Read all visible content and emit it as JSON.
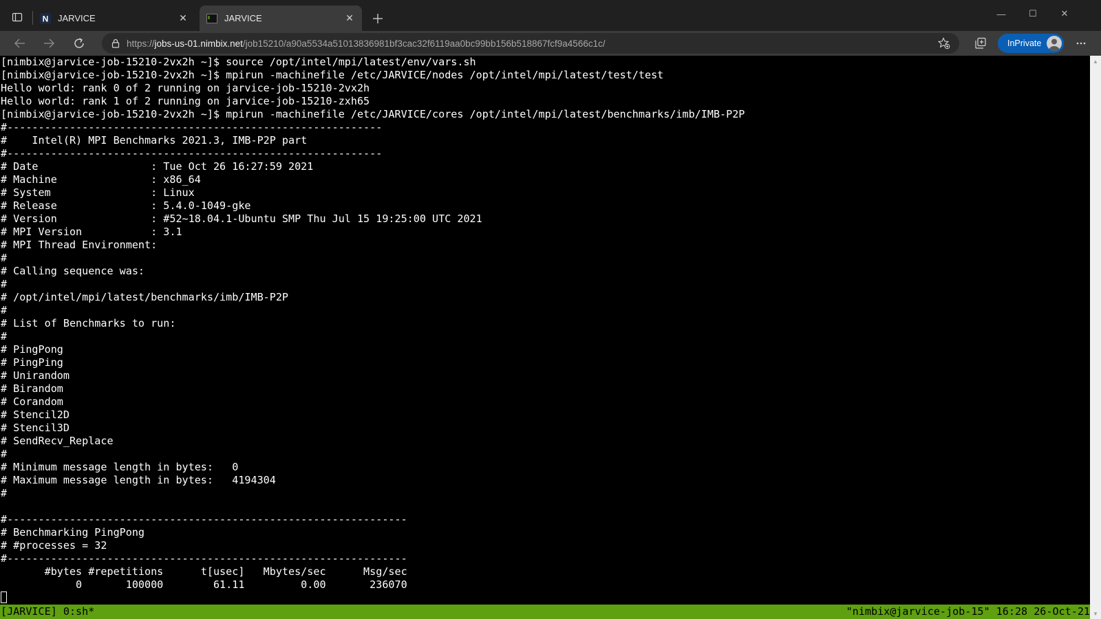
{
  "browser": {
    "tabs": [
      {
        "title": "JARVICE",
        "favicon": "N",
        "active": false
      },
      {
        "title": "JARVICE",
        "favicon": "terminal",
        "active": true
      }
    ],
    "window_controls": {
      "minimize": "—",
      "maximize": "☐",
      "close": "✕"
    },
    "url": {
      "scheme": "https://",
      "host": "jobs-us-01.nimbix.net",
      "path": "/job15210/a90a5534a51013836981bf3cac32f6119aa0bc99bb156b518867fcf9a4566c1c/"
    },
    "inprivate_label": "InPrivate",
    "colors": {
      "frame": "#202020",
      "toolbar": "#3b3b3b",
      "inprivate": "#0a5fb4"
    }
  },
  "terminal": {
    "lines": [
      "[nimbix@jarvice-job-15210-2vx2h ~]$ source /opt/intel/mpi/latest/env/vars.sh",
      "[nimbix@jarvice-job-15210-2vx2h ~]$ mpirun -machinefile /etc/JARVICE/nodes /opt/intel/mpi/latest/test/test",
      "Hello world: rank 0 of 2 running on jarvice-job-15210-2vx2h",
      "Hello world: rank 1 of 2 running on jarvice-job-15210-zxh65",
      "[nimbix@jarvice-job-15210-2vx2h ~]$ mpirun -machinefile /etc/JARVICE/cores /opt/intel/mpi/latest/benchmarks/imb/IMB-P2P",
      "#------------------------------------------------------------",
      "#    Intel(R) MPI Benchmarks 2021.3, IMB-P2P part",
      "#------------------------------------------------------------",
      "# Date                  : Tue Oct 26 16:27:59 2021",
      "# Machine               : x86_64",
      "# System                : Linux",
      "# Release               : 5.4.0-1049-gke",
      "# Version               : #52~18.04.1-Ubuntu SMP Thu Jul 15 19:25:00 UTC 2021",
      "# MPI Version           : 3.1",
      "# MPI Thread Environment:",
      "#",
      "# Calling sequence was:",
      "#",
      "# /opt/intel/mpi/latest/benchmarks/imb/IMB-P2P",
      "#",
      "# List of Benchmarks to run:",
      "#",
      "# PingPong",
      "# PingPing",
      "# Unirandom",
      "# Birandom",
      "# Corandom",
      "# Stencil2D",
      "# Stencil3D",
      "# SendRecv_Replace",
      "#",
      "# Minimum message length in bytes:   0",
      "# Maximum message length in bytes:   4194304",
      "#",
      "",
      "#----------------------------------------------------------------",
      "# Benchmarking PingPong",
      "# #processes = 32",
      "#----------------------------------------------------------------",
      "       #bytes #repetitions      t[usec]   Mbytes/sec      Msg/sec",
      "            0       100000        61.11         0.00       236070"
    ],
    "colors": {
      "background": "#000000",
      "foreground": "#ffffff"
    }
  },
  "status": {
    "left": "[JARVICE] 0:sh*",
    "right": "\"nimbix@jarvice-job-15\" 16:28 26-Oct-21",
    "color": "#5fa010"
  }
}
